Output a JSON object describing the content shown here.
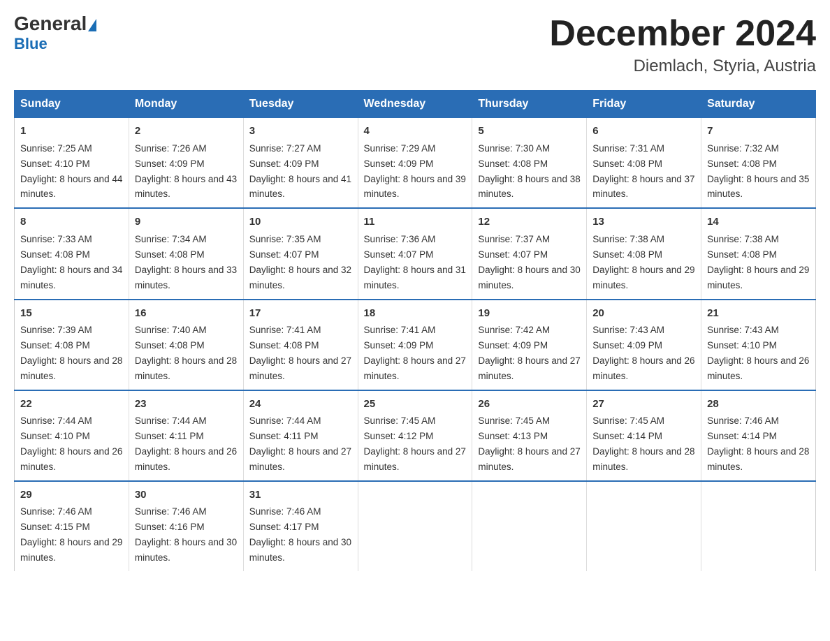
{
  "logo": {
    "general": "General",
    "blue": "Blue"
  },
  "title": "December 2024",
  "subtitle": "Diemlach, Styria, Austria",
  "days": [
    "Sunday",
    "Monday",
    "Tuesday",
    "Wednesday",
    "Thursday",
    "Friday",
    "Saturday"
  ],
  "weeks": [
    [
      {
        "num": "1",
        "sunrise": "7:25 AM",
        "sunset": "4:10 PM",
        "daylight": "8 hours and 44 minutes."
      },
      {
        "num": "2",
        "sunrise": "7:26 AM",
        "sunset": "4:09 PM",
        "daylight": "8 hours and 43 minutes."
      },
      {
        "num": "3",
        "sunrise": "7:27 AM",
        "sunset": "4:09 PM",
        "daylight": "8 hours and 41 minutes."
      },
      {
        "num": "4",
        "sunrise": "7:29 AM",
        "sunset": "4:09 PM",
        "daylight": "8 hours and 39 minutes."
      },
      {
        "num": "5",
        "sunrise": "7:30 AM",
        "sunset": "4:08 PM",
        "daylight": "8 hours and 38 minutes."
      },
      {
        "num": "6",
        "sunrise": "7:31 AM",
        "sunset": "4:08 PM",
        "daylight": "8 hours and 37 minutes."
      },
      {
        "num": "7",
        "sunrise": "7:32 AM",
        "sunset": "4:08 PM",
        "daylight": "8 hours and 35 minutes."
      }
    ],
    [
      {
        "num": "8",
        "sunrise": "7:33 AM",
        "sunset": "4:08 PM",
        "daylight": "8 hours and 34 minutes."
      },
      {
        "num": "9",
        "sunrise": "7:34 AM",
        "sunset": "4:08 PM",
        "daylight": "8 hours and 33 minutes."
      },
      {
        "num": "10",
        "sunrise": "7:35 AM",
        "sunset": "4:07 PM",
        "daylight": "8 hours and 32 minutes."
      },
      {
        "num": "11",
        "sunrise": "7:36 AM",
        "sunset": "4:07 PM",
        "daylight": "8 hours and 31 minutes."
      },
      {
        "num": "12",
        "sunrise": "7:37 AM",
        "sunset": "4:07 PM",
        "daylight": "8 hours and 30 minutes."
      },
      {
        "num": "13",
        "sunrise": "7:38 AM",
        "sunset": "4:08 PM",
        "daylight": "8 hours and 29 minutes."
      },
      {
        "num": "14",
        "sunrise": "7:38 AM",
        "sunset": "4:08 PM",
        "daylight": "8 hours and 29 minutes."
      }
    ],
    [
      {
        "num": "15",
        "sunrise": "7:39 AM",
        "sunset": "4:08 PM",
        "daylight": "8 hours and 28 minutes."
      },
      {
        "num": "16",
        "sunrise": "7:40 AM",
        "sunset": "4:08 PM",
        "daylight": "8 hours and 28 minutes."
      },
      {
        "num": "17",
        "sunrise": "7:41 AM",
        "sunset": "4:08 PM",
        "daylight": "8 hours and 27 minutes."
      },
      {
        "num": "18",
        "sunrise": "7:41 AM",
        "sunset": "4:09 PM",
        "daylight": "8 hours and 27 minutes."
      },
      {
        "num": "19",
        "sunrise": "7:42 AM",
        "sunset": "4:09 PM",
        "daylight": "8 hours and 27 minutes."
      },
      {
        "num": "20",
        "sunrise": "7:43 AM",
        "sunset": "4:09 PM",
        "daylight": "8 hours and 26 minutes."
      },
      {
        "num": "21",
        "sunrise": "7:43 AM",
        "sunset": "4:10 PM",
        "daylight": "8 hours and 26 minutes."
      }
    ],
    [
      {
        "num": "22",
        "sunrise": "7:44 AM",
        "sunset": "4:10 PM",
        "daylight": "8 hours and 26 minutes."
      },
      {
        "num": "23",
        "sunrise": "7:44 AM",
        "sunset": "4:11 PM",
        "daylight": "8 hours and 26 minutes."
      },
      {
        "num": "24",
        "sunrise": "7:44 AM",
        "sunset": "4:11 PM",
        "daylight": "8 hours and 27 minutes."
      },
      {
        "num": "25",
        "sunrise": "7:45 AM",
        "sunset": "4:12 PM",
        "daylight": "8 hours and 27 minutes."
      },
      {
        "num": "26",
        "sunrise": "7:45 AM",
        "sunset": "4:13 PM",
        "daylight": "8 hours and 27 minutes."
      },
      {
        "num": "27",
        "sunrise": "7:45 AM",
        "sunset": "4:14 PM",
        "daylight": "8 hours and 28 minutes."
      },
      {
        "num": "28",
        "sunrise": "7:46 AM",
        "sunset": "4:14 PM",
        "daylight": "8 hours and 28 minutes."
      }
    ],
    [
      {
        "num": "29",
        "sunrise": "7:46 AM",
        "sunset": "4:15 PM",
        "daylight": "8 hours and 29 minutes."
      },
      {
        "num": "30",
        "sunrise": "7:46 AM",
        "sunset": "4:16 PM",
        "daylight": "8 hours and 30 minutes."
      },
      {
        "num": "31",
        "sunrise": "7:46 AM",
        "sunset": "4:17 PM",
        "daylight": "8 hours and 30 minutes."
      },
      null,
      null,
      null,
      null
    ]
  ],
  "labels": {
    "sunrise": "Sunrise:",
    "sunset": "Sunset:",
    "daylight": "Daylight:"
  }
}
